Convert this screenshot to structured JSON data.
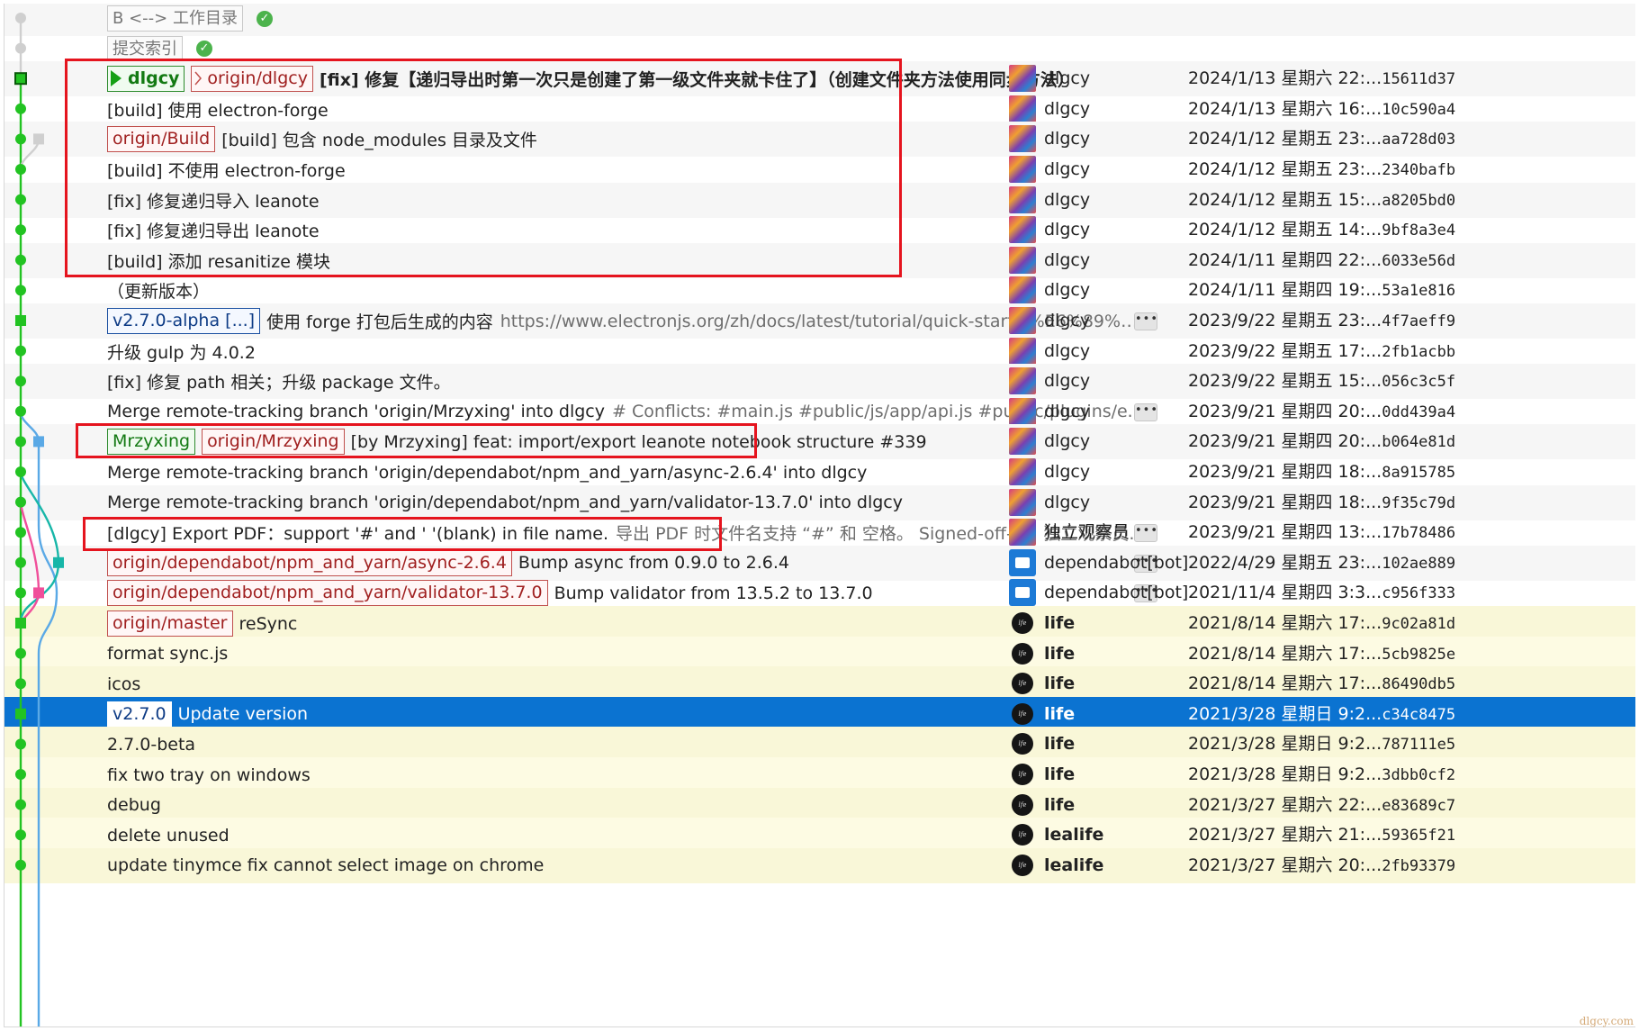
{
  "rows": [
    {
      "refs": [
        {
          "type": "gray",
          "text": "B <--> 工作目录"
        }
      ],
      "check": true,
      "subject": "",
      "author": "",
      "date": "",
      "sha": ""
    },
    {
      "refs": [
        {
          "type": "gray",
          "text": "提交索引"
        }
      ],
      "check": true,
      "subject": "",
      "author": "",
      "date": "",
      "sha": ""
    },
    {
      "refs": [
        {
          "type": "localhead",
          "text": "dlgcy"
        },
        {
          "type": "remotehead",
          "text": "origin/dlgcy"
        }
      ],
      "subject": "[fix] 修复【递归导出时第一次只是创建了第一级文件夹就卡住了】（创建文件夹方法使用同步方法）",
      "bold": true,
      "avatar": "colorful",
      "author": "dlgcy",
      "date": "2024/1/13 星期六 22:...",
      "sha": "15611d37"
    },
    {
      "refs": [],
      "subject": "[build] 使用 electron-forge",
      "avatar": "colorful",
      "author": "dlgcy",
      "date": "2024/1/13 星期六 16:...",
      "sha": "10c590a4"
    },
    {
      "refs": [
        {
          "type": "remote",
          "text": "origin/Build"
        }
      ],
      "subject": "[build] 包含 node_modules 目录及文件",
      "avatar": "colorful",
      "author": "dlgcy",
      "date": "2024/1/12 星期五 23:...",
      "sha": "aa728d03"
    },
    {
      "refs": [],
      "subject": "[build] 不使用 electron-forge",
      "avatar": "colorful",
      "author": "dlgcy",
      "date": "2024/1/12 星期五 23:...",
      "sha": "2340bafb"
    },
    {
      "refs": [],
      "subject": "[fix] 修复递归导入 leanote",
      "avatar": "colorful",
      "author": "dlgcy",
      "date": "2024/1/12 星期五 15:...",
      "sha": "a8205bd0"
    },
    {
      "refs": [],
      "subject": "[fix] 修复递归导出 leanote",
      "avatar": "colorful",
      "author": "dlgcy",
      "date": "2024/1/12 星期五 14:...",
      "sha": "9bf8a3e4"
    },
    {
      "refs": [],
      "subject": "[build] 添加 resanitize 模块",
      "avatar": "colorful",
      "author": "dlgcy",
      "date": "2024/1/11 星期四 22:...",
      "sha": "6033e56d"
    },
    {
      "refs": [],
      "subject": "（更新版本）",
      "avatar": "colorful",
      "author": "dlgcy",
      "date": "2024/1/11 星期四 19:...",
      "sha": "53a1e816"
    },
    {
      "refs": [
        {
          "type": "tag",
          "text": "v2.7.0-alpha [...]"
        }
      ],
      "subject": "使用 forge 打包后生成的内容",
      "body": "https://www.electronjs.org/zh/docs/latest/tutorial/quick-start#%E6%89%93%E5%8...",
      "dots": "•••",
      "avatar": "colorful",
      "author": "dlgcy",
      "date": "2023/9/22 星期五 23:...",
      "sha": "4f7aeff9"
    },
    {
      "refs": [],
      "subject": "升级 gulp 为 4.0.2",
      "avatar": "colorful",
      "author": "dlgcy",
      "date": "2023/9/22 星期五 17:...",
      "sha": "2fb1acbb"
    },
    {
      "refs": [],
      "subject": "[fix] 修复 path 相关；升级 package 文件。",
      "avatar": "colorful",
      "author": "dlgcy",
      "date": "2023/9/22 星期五 15:...",
      "sha": "056c3c5f"
    },
    {
      "refs": [],
      "subject": "Merge remote-tracking branch 'origin/Mrzyxing' into dlgcy",
      "body": "# Conflicts: #main.js #public/js/app/api.js #public/plugins/export_lean...",
      "dots": "•••",
      "avatar": "colorful",
      "author": "dlgcy",
      "date": "2023/9/21 星期四 20:...",
      "sha": "0dd439a4"
    },
    {
      "refs": [
        {
          "type": "local",
          "text": "Mrzyxing"
        },
        {
          "type": "remote",
          "text": "origin/Mrzyxing"
        }
      ],
      "subject": "[by Mrzyxing] feat: import/export leanote notebook structure #339",
      "avatar": "colorful",
      "author": "dlgcy",
      "date": "2023/9/21 星期四 20:...",
      "sha": "b064e81d"
    },
    {
      "refs": [],
      "subject": "Merge remote-tracking branch 'origin/dependabot/npm_and_yarn/async-2.6.4' into dlgcy",
      "avatar": "colorful",
      "author": "dlgcy",
      "date": "2023/9/21 星期四 18:...",
      "sha": "8a915785"
    },
    {
      "refs": [],
      "subject": "Merge remote-tracking branch 'origin/dependabot/npm_and_yarn/validator-13.7.0' into dlgcy",
      "avatar": "colorful",
      "author": "dlgcy",
      "date": "2023/9/21 星期四 18:...",
      "sha": "9f35c79d"
    },
    {
      "refs": [],
      "subject": "[dlgcy] Export PDF：support '#' and ' '(blank) in file name.",
      "body": "导出 PDF 时文件名支持 “#” 和 空格。 Signed-off-by: 独立观察员 <dlgcywl...",
      "dots": "•••",
      "avatar": "colorful",
      "author": "独立观察员",
      "date": "2023/9/21 星期四 13:...",
      "sha": "17b78486"
    },
    {
      "refs": [
        {
          "type": "remote",
          "text": "origin/dependabot/npm_and_yarn/async-2.6.4"
        }
      ],
      "subject": "Bump async from 0.9.0 to 2.6.4",
      "dots": "•••",
      "avatar": "bot",
      "author": "dependabot[bot]",
      "date": "2022/4/29 星期五 23:...",
      "sha": "102ae889"
    },
    {
      "refs": [
        {
          "type": "remote",
          "text": "origin/dependabot/npm_and_yarn/validator-13.7.0"
        }
      ],
      "subject": "Bump validator from 13.5.2 to 13.7.0",
      "dots": "•••",
      "avatar": "bot",
      "author": "dependabot[bot]",
      "date": "2021/11/4 星期四 3:3...",
      "sha": "c956f333"
    },
    {
      "refs": [
        {
          "type": "remote",
          "text": "origin/master"
        }
      ],
      "subject": "reSync",
      "hl": true,
      "avatar": "life",
      "author": "life",
      "authorBold": true,
      "date": "2021/8/14 星期六 17:...",
      "sha": "9c02a81d"
    },
    {
      "refs": [],
      "subject": "format sync.js",
      "hl": true,
      "avatar": "life",
      "author": "life",
      "authorBold": true,
      "date": "2021/8/14 星期六 17:...",
      "sha": "5cb9825e"
    },
    {
      "refs": [],
      "subject": "icos",
      "hl": true,
      "avatar": "life",
      "author": "life",
      "authorBold": true,
      "date": "2021/8/14 星期六 17:...",
      "sha": "86490db5"
    },
    {
      "refs": [
        {
          "type": "tag-sel",
          "text": "v2.7.0"
        }
      ],
      "subject": "Update version",
      "selected": true,
      "avatar": "life",
      "author": "life",
      "authorBold": true,
      "date": "2021/3/28 星期日 9:2...",
      "sha": "c34c8475"
    },
    {
      "refs": [],
      "subject": "2.7.0-beta",
      "hl": true,
      "avatar": "life",
      "author": "life",
      "authorBold": true,
      "date": "2021/3/28 星期日 9:2...",
      "sha": "787111e5"
    },
    {
      "refs": [],
      "subject": "fix two tray on windows",
      "hl": true,
      "avatar": "life",
      "author": "life",
      "authorBold": true,
      "date": "2021/3/28 星期日 9:2...",
      "sha": "3dbb0cf2"
    },
    {
      "refs": [],
      "subject": "debug",
      "hl": true,
      "avatar": "life",
      "author": "life",
      "authorBold": true,
      "date": "2021/3/27 星期六 22:...",
      "sha": "e83689c7"
    },
    {
      "refs": [],
      "subject": "delete unused",
      "hl": true,
      "avatar": "life",
      "author": "lealife",
      "authorBold": true,
      "date": "2021/3/27 星期六 21:...",
      "sha": "59365f21"
    },
    {
      "refs": [],
      "subject": "update tinymce fix cannot select image on chrome",
      "hl": true,
      "avatar": "life",
      "author": "lealife",
      "authorBold": true,
      "date": "2021/3/27 星期六 20:...",
      "sha": "2fb93379"
    }
  ],
  "avatar_text": "lfe",
  "watermark": "dlgcy.com",
  "colors": {
    "main_lane": "#22c322",
    "branch_lane": "#5aa9e6",
    "teal_lane": "#17b6a8",
    "pink_lane": "#f04f9a",
    "gray_lane": "#cfcfcf",
    "selected_row": "#0b73d1",
    "highlight_rows": "#fdfbe3",
    "annotation_box": "#e5141e"
  }
}
